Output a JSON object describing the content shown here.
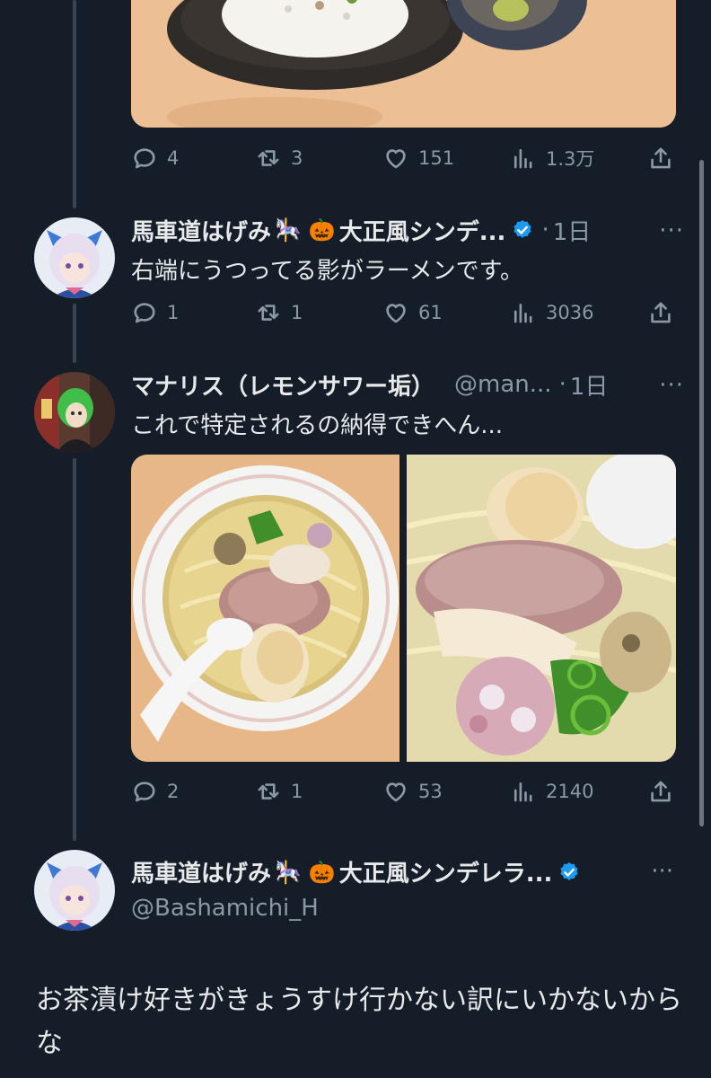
{
  "tweet1": {
    "actions": {
      "replies": "4",
      "retweets": "3",
      "likes": "151",
      "views": "1.3万"
    }
  },
  "tweet2": {
    "name": "馬車道はげみ",
    "emoji1": "🎠",
    "emoji2": "🎃",
    "name_suffix": "大正風シンデ...",
    "time": "1日",
    "more": "···",
    "text": "右端にうつってる影がラーメンです。",
    "actions": {
      "replies": "1",
      "retweets": "1",
      "likes": "61",
      "views": "3036"
    }
  },
  "tweet3": {
    "name": "マナリス（レモンサワー垢）",
    "handle": "@man...",
    "time": "1日",
    "more": "···",
    "text": "これで特定されるの納得できへん...",
    "actions": {
      "replies": "2",
      "retweets": "1",
      "likes": "53",
      "views": "2140"
    }
  },
  "main_tweet": {
    "name": "馬車道はげみ",
    "emoji1": "🎠",
    "emoji2": "🎃",
    "name_suffix": "大正風シンデレラ...",
    "handle": "@Bashamichi_H",
    "more": "···",
    "text": "お茶漬け好きがきょうすけ行かない訳にいかないからな"
  },
  "colors": {
    "background": "#151d28",
    "text": "#e7e9ea",
    "secondary": "#8b98a5",
    "verified": "#1d9bf0"
  },
  "icons": [
    "reply-icon",
    "retweet-icon",
    "like-icon",
    "views-icon",
    "share-icon",
    "verified-icon",
    "more-icon"
  ]
}
